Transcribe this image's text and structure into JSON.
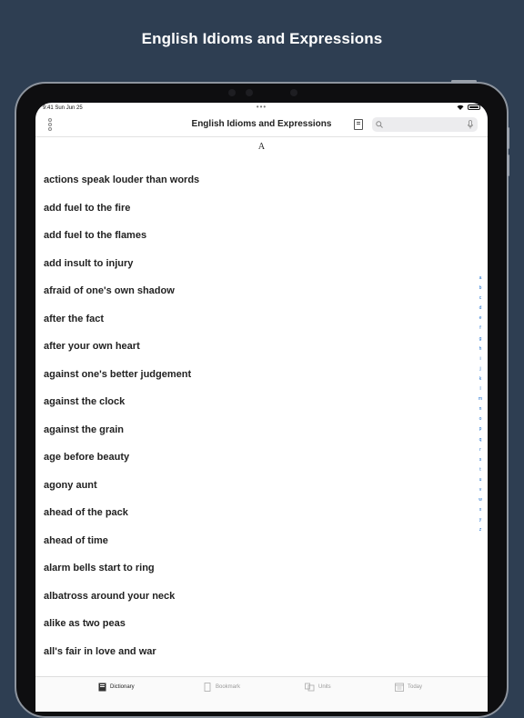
{
  "promo": {
    "headline": "English Idioms and Expressions"
  },
  "status_bar": {
    "time": "9:41  Sun Jun 25",
    "dots": "•••"
  },
  "navbar": {
    "title": "English Idioms and Expressions"
  },
  "section_letter": "A",
  "entries": [
    "actions speak louder than words",
    "add fuel to the fire",
    "add fuel to the flames",
    "add insult to injury",
    "afraid of one's own shadow",
    "after the fact",
    "after your own heart",
    "against one's better judgement",
    "against the clock",
    "against the grain",
    "age before beauty",
    "agony aunt",
    "ahead of the pack",
    "ahead of time",
    "alarm bells start to ring",
    "albatross around your neck",
    "alike as two peas",
    "all's fair in love and war"
  ],
  "index_letters": [
    "a",
    "b",
    "c",
    "d",
    "e",
    "f",
    "g",
    "h",
    "i",
    "j",
    "k",
    "l",
    "m",
    "n",
    "o",
    "p",
    "q",
    "r",
    "s",
    "t",
    "u",
    "v",
    "w",
    "x",
    "y",
    "z"
  ],
  "tabs": [
    {
      "label": "Dictionary",
      "icon": "dictionary-icon",
      "active": true
    },
    {
      "label": "Bookmark",
      "icon": "bookmark-icon",
      "active": false
    },
    {
      "label": "Units",
      "icon": "units-icon",
      "active": false
    },
    {
      "label": "Today",
      "icon": "calendar-icon",
      "active": false
    }
  ]
}
